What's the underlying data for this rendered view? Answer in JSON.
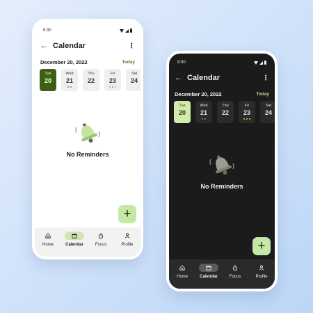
{
  "colors": {
    "accent_light": "#3f5f10",
    "accent_dark": "#d2eda8",
    "fab": "#c6e8a6",
    "dot_red": "#e0645a",
    "dot_gray": "#b5b5b5",
    "dot_yellow": "#e0c64a"
  },
  "light": {
    "status": {
      "time": "9:30"
    },
    "header": {
      "title": "Calendar"
    },
    "date": {
      "label": "December 20, 2022",
      "today": "Today"
    },
    "days": [
      {
        "name": "Tue",
        "num": "20"
      },
      {
        "name": "Wed",
        "num": "21"
      },
      {
        "name": "Thu",
        "num": "22"
      },
      {
        "name": "Fri",
        "num": "23"
      },
      {
        "name": "Sat",
        "num": "24"
      }
    ],
    "empty": {
      "text": "No Reminders"
    },
    "fab": {
      "icon": "+"
    },
    "nav": [
      {
        "label": "Home",
        "icon": "home-icon"
      },
      {
        "label": "Calendar",
        "icon": "calendar-icon"
      },
      {
        "label": "Focus",
        "icon": "timer-icon"
      },
      {
        "label": "Profile",
        "icon": "person-icon"
      }
    ]
  },
  "dark": {
    "status": {
      "time": "9:30"
    },
    "header": {
      "title": "Calendar"
    },
    "date": {
      "label": "December 20, 2022",
      "today": "Today"
    },
    "days": [
      {
        "name": "Tue",
        "num": "20"
      },
      {
        "name": "Wed",
        "num": "21"
      },
      {
        "name": "Thu",
        "num": "22"
      },
      {
        "name": "Fri",
        "num": "23"
      },
      {
        "name": "Sat",
        "num": "24"
      }
    ],
    "empty": {
      "text": "No Reminders"
    },
    "fab": {
      "icon": "+"
    },
    "nav": [
      {
        "label": "Home",
        "icon": "home-icon"
      },
      {
        "label": "Calendar",
        "icon": "calendar-icon"
      },
      {
        "label": "Focus",
        "icon": "timer-icon"
      },
      {
        "label": "Profile",
        "icon": "person-icon"
      }
    ]
  }
}
